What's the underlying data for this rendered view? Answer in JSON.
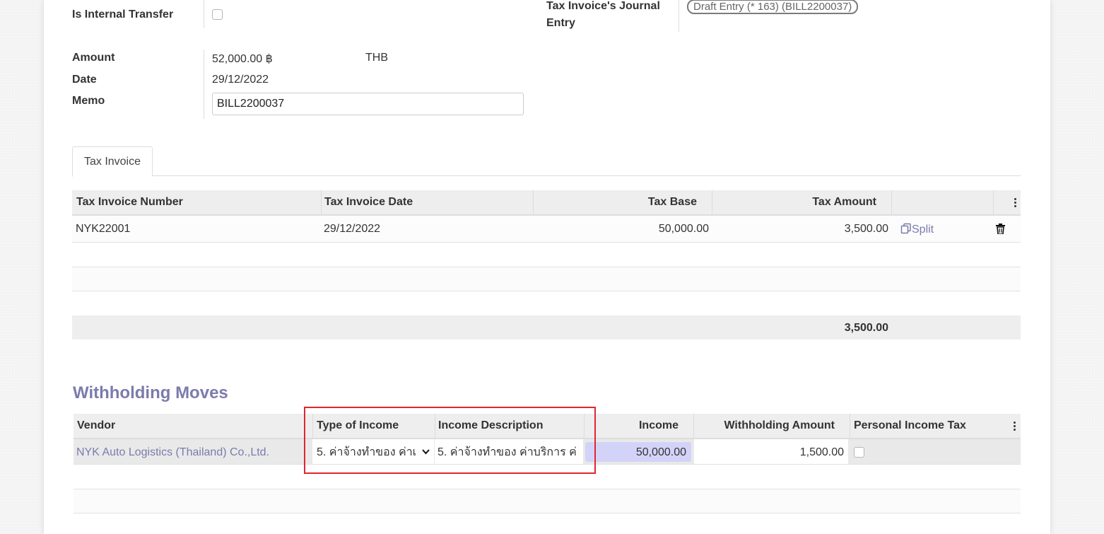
{
  "form": {
    "internal_transfer_label": "Is Internal Transfer",
    "journal_entry_label_1": "Tax Invoice's Journal",
    "journal_entry_label_2": "Entry",
    "journal_entry_value": "Draft Entry (* 163) (BILL2200037)",
    "amount_label": "Amount",
    "amount_value": "52,000.00 ฿",
    "currency_value": "THB",
    "date_label": "Date",
    "date_value": "29/12/2022",
    "memo_label": "Memo",
    "memo_value": "BILL2200037"
  },
  "tabs": [
    {
      "label": "Tax Invoice"
    }
  ],
  "tax_table": {
    "columns": [
      "Tax Invoice Number",
      "Tax Invoice Date",
      "Tax Base",
      "Tax Amount"
    ],
    "rows": [
      {
        "number": "NYK22001",
        "date": "29/12/2022",
        "base": "50,000.00",
        "amount": "3,500.00",
        "split_label": "Split"
      }
    ],
    "total": "3,500.00"
  },
  "withholding": {
    "title": "Withholding Moves",
    "columns": [
      "Vendor",
      "Type of Income",
      "Income Description",
      "Income",
      "Withholding Amount",
      "Personal Income Tax"
    ],
    "rows": [
      {
        "vendor": "NYK Auto Logistics (Thailand) Co.,Ltd.",
        "type_of_income": "5. ค่าจ้างทำของ ค่าเ",
        "income_description": "5. ค่าจ้างทำของ ค่าบริการ ค่",
        "income": "50,000.00",
        "withholding_amount": "1,500.00"
      }
    ]
  },
  "icons": {
    "split": "copy-icon",
    "delete": "trash-icon",
    "options": "kebab-menu-icon",
    "dropdown": "chevron-down-icon"
  },
  "colors": {
    "accent": "#7c7bad",
    "highlight": "#e0262d",
    "income_bg": "#d3d3fa"
  }
}
